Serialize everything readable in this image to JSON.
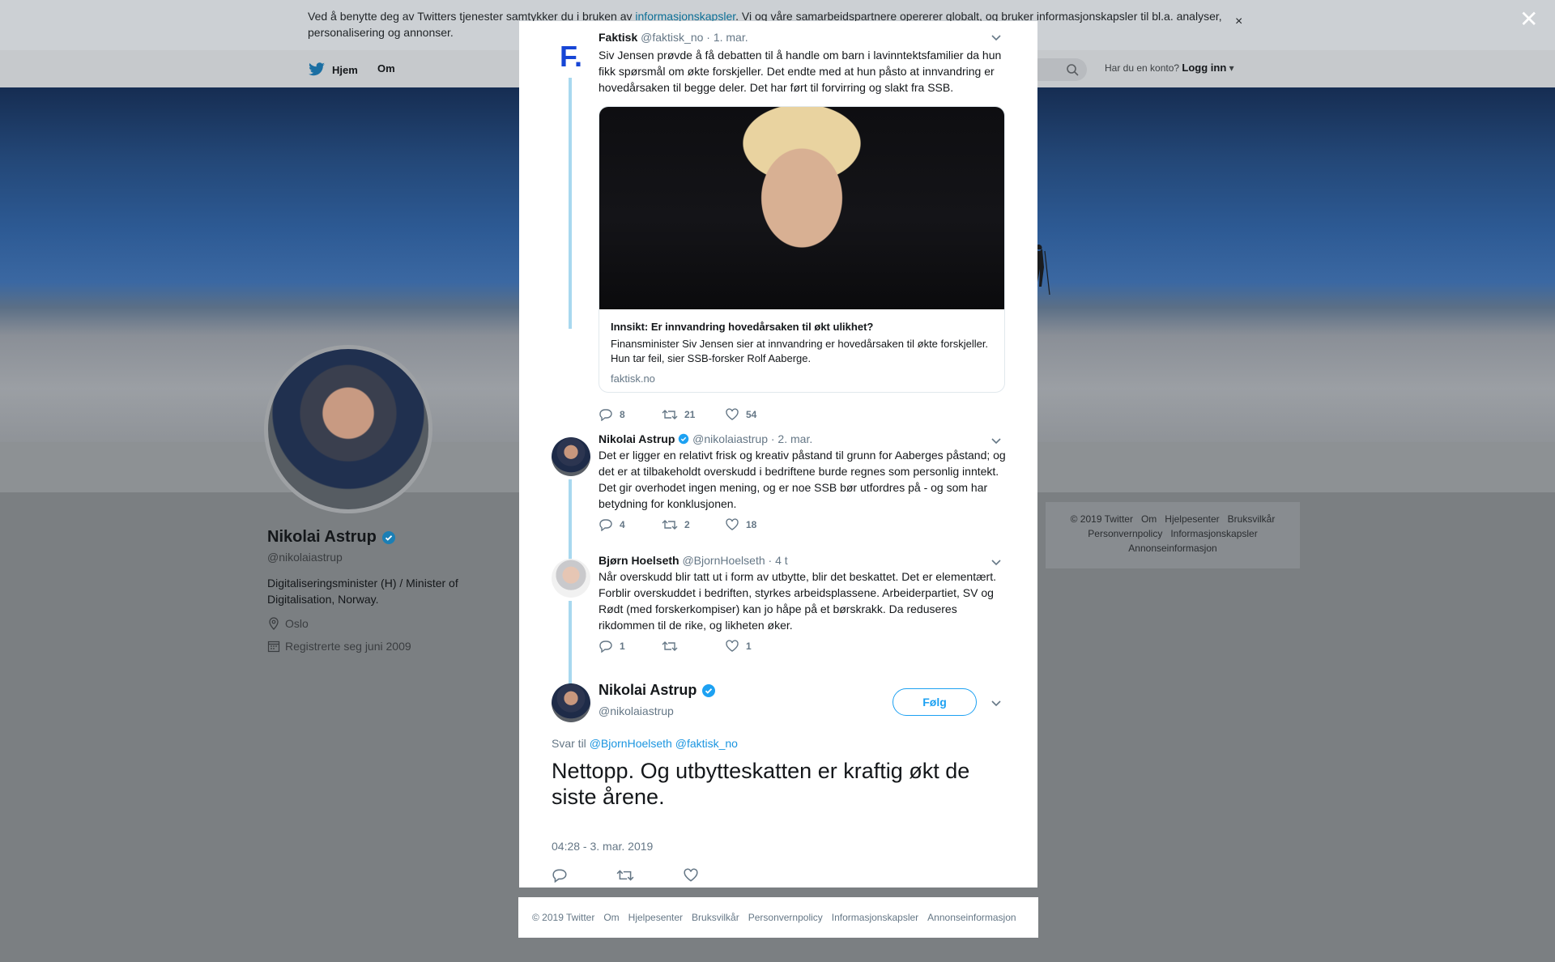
{
  "cookie": {
    "text_before": "Ved å benytte deg av Twitters tjenester samtykker du i bruken av ",
    "link": "informasjonskapsler",
    "text_after": ". Vi og våre samarbeidspartnere opererer globalt, og bruker informasjonskapsler til bl.a. analyser, personalisering og annonser.",
    "close": "×"
  },
  "nav": {
    "home": "Hjem",
    "about": "Om",
    "login_prompt": "Har du en konto?",
    "login": "Logg inn"
  },
  "profile": {
    "name": "Nikolai Astrup",
    "handle": "@nikolaiastrup",
    "bio": "Digitaliseringsminister (H) / Minister of Digitalisation, Norway.",
    "location": "Oslo",
    "joined": "Registrerte seg juni 2009"
  },
  "side_footer": {
    "items": [
      "© 2019 Twitter",
      "Om",
      "Hjelpesenter",
      "Bruksvilkår",
      "Personvernpolicy",
      "Informasjonskapsler",
      "Annonseinformasjon"
    ]
  },
  "overlay_close": "✕",
  "tweets": [
    {
      "avatar_letter": "F.",
      "name": "Faktisk",
      "handle": "@faktisk_no",
      "date": "· 1. mar.",
      "text": "Siv Jensen prøvde å få debatten til å handle om barn i lavinntektsfamilier da hun fikk spørsmål om økte forskjeller. Det endte med at hun påsto at innvandring er hovedårsaken til begge deler. Det har ført til forvirring og slakt fra SSB.",
      "card": {
        "title": "Innsikt: Er innvandring hovedårsaken til økt ulikhet?",
        "description": "Finansminister Siv Jensen sier at innvandring er hovedårsaken til økte forskjeller. Hun tar feil, sier SSB-forsker Rolf Aaberge.",
        "domain": "faktisk.no"
      },
      "replies": "8",
      "retweets": "21",
      "likes": "54"
    },
    {
      "name": "Nikolai Astrup",
      "handle": "@nikolaiastrup",
      "date": "· 2. mar.",
      "text": "Det er ligger en relativt frisk og kreativ påstand til grunn for Aaberges påstand; og det er at tilbakeholdt overskudd i bedriftene burde regnes som personlig inntekt. Det gir overhodet ingen mening, og er noe SSB bør utfordres på - og som har betydning for konklusjonen.",
      "replies": "4",
      "retweets": "2",
      "likes": "18"
    },
    {
      "name": "Bjørn Hoelseth",
      "handle": "@BjornHoelseth",
      "date": "· 4 t",
      "text": "Når overskudd blir tatt ut i form av utbytte, blir det beskattet. Det er elementært. Forblir overskuddet i bedriften, styrkes arbeidsplassene. Arbeiderpartiet, SV og Rødt (med forskerkompiser) kan jo håpe på et børskrakk. Da reduseres rikdommen til de rike, og likheten øker.",
      "replies": "1",
      "retweets": "",
      "likes": "1"
    }
  ],
  "main_tweet": {
    "name": "Nikolai Astrup",
    "handle": "@nikolaiastrup",
    "follow": "Følg",
    "reply_prefix": "Svar til",
    "reply_users": "@BjornHoelseth @faktisk_no",
    "text": "Nettopp. Og utbytteskatten er kraftig økt de siste årene.",
    "time": "04:28 - 3. mar. 2019"
  },
  "footer": {
    "items": [
      "© 2019 Twitter",
      "Om",
      "Hjelpesenter",
      "Bruksvilkår",
      "Personvernpolicy",
      "Informasjonskapsler",
      "Annonseinformasjon"
    ]
  },
  "colors": {
    "accent": "#1da1f2",
    "verified": "#1da1f2",
    "thread_line": "#a8d8ef"
  }
}
